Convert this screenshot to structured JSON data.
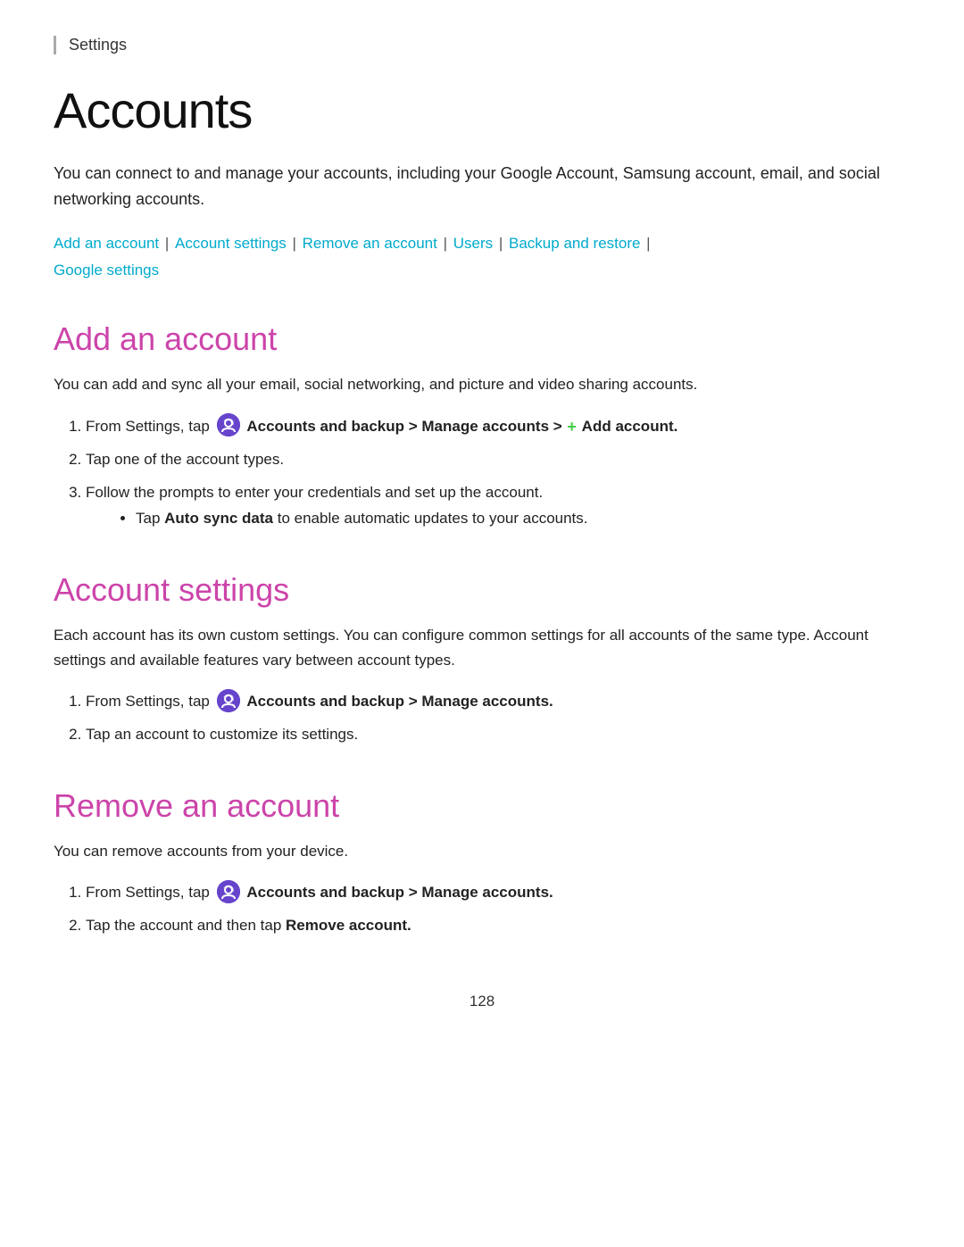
{
  "header": {
    "settings_label": "Settings"
  },
  "page": {
    "title": "Accounts",
    "intro": "You can connect to and manage your accounts, including your Google Account, Samsung account, email, and social networking accounts.",
    "nav_links": [
      {
        "label": "Add an account",
        "id": "add-an-account"
      },
      {
        "label": "Account settings",
        "id": "account-settings"
      },
      {
        "label": "Remove an account",
        "id": "remove-an-account"
      },
      {
        "label": "Users",
        "id": "users"
      },
      {
        "label": "Backup and restore",
        "id": "backup-and-restore"
      },
      {
        "label": "Google settings",
        "id": "google-settings"
      }
    ]
  },
  "sections": {
    "add_account": {
      "title": "Add an account",
      "desc": "You can add and sync all your email, social networking, and picture and video sharing accounts.",
      "steps": [
        {
          "text_before": "From Settings, tap",
          "icon": "accounts-icon",
          "bold_text": "Accounts and backup > Manage accounts >",
          "icon2": "plus-icon",
          "bold_text2": "Add account.",
          "has_icon2": true
        },
        {
          "text": "Tap one of the account types."
        },
        {
          "text": "Follow the prompts to enter your credentials and set up the account."
        }
      ],
      "bullet": "Tap Auto sync data to enable automatic updates to your accounts.",
      "bullet_bold": "Auto sync data"
    },
    "account_settings": {
      "title": "Account settings",
      "desc": "Each account has its own custom settings. You can configure common settings for all accounts of the same type. Account settings and available features vary between account types.",
      "steps": [
        {
          "text_before": "From Settings, tap",
          "icon": "accounts-icon",
          "bold_text": "Accounts and backup > Manage accounts."
        },
        {
          "text": "Tap an account to customize its settings."
        }
      ]
    },
    "remove_account": {
      "title": "Remove an account",
      "desc": "You can remove accounts from your device.",
      "steps": [
        {
          "text_before": "From Settings, tap",
          "icon": "accounts-icon",
          "bold_text": "Accounts and backup > Manage accounts."
        },
        {
          "text_before": "Tap the account and then tap",
          "bold_text": "Remove account."
        }
      ]
    }
  },
  "footer": {
    "page_number": "128"
  }
}
